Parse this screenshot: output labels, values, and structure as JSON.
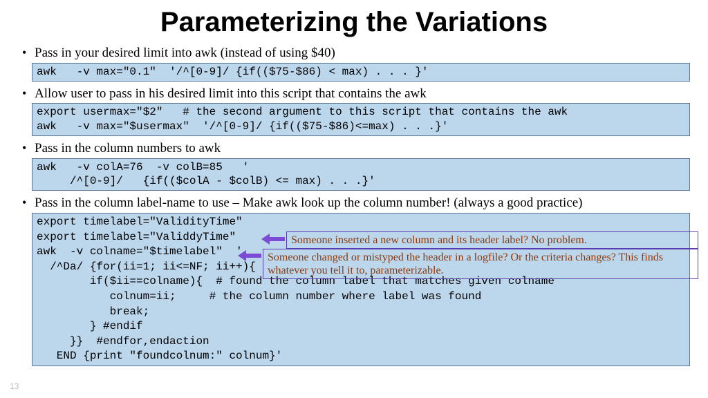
{
  "title": "Parameterizing the Variations",
  "bullets": {
    "b1": "Pass in your desired limit into awk (instead of using $40)",
    "b2": "Allow user to pass in his desired limit into this script that contains the awk",
    "b3": "Pass in the column numbers to awk",
    "b4": "Pass in the column label-name to use – Make awk look up the column number! (always a good practice)"
  },
  "code": {
    "c1": "awk   -v max=\"0.1\"  '/^[0-9]/ {if(($75-$86) < max) . . . }'",
    "c2": "export usermax=\"$2\"   # the second argument to this script that contains the awk\nawk   -v max=\"$usermax\"  '/^[0-9]/ {if(($75-$86)<=max) . . .}'",
    "c3": "awk   -v colA=76  -v colB=85   '\n     /^[0-9]/   {if(($colA - $colB) <= max) . . .}'",
    "c4": "export timelabel=\"ValidityTime\"\nexport timelabel=\"ValiddyTime\"\nawk  -v colname=\"$timelabel\"  '\n  /^Da/ {for(ii=1; ii<=NF; ii++){\n        if($ii==colname){  # found the column label that matches given colname\n           colnum=ii;     # the column number where label was found\n           break;\n        } #endif\n     }}  #endfor,endaction\n   END {print \"foundcolnum:\" colnum}'"
  },
  "callouts": {
    "a1": "Someone inserted a new column and its header label? No problem.",
    "a2": "Someone changed or mistyped the header in a logfile?  Or the criteria changes? This finds whatever you tell it to, parameterizable."
  },
  "pagenum": "13"
}
